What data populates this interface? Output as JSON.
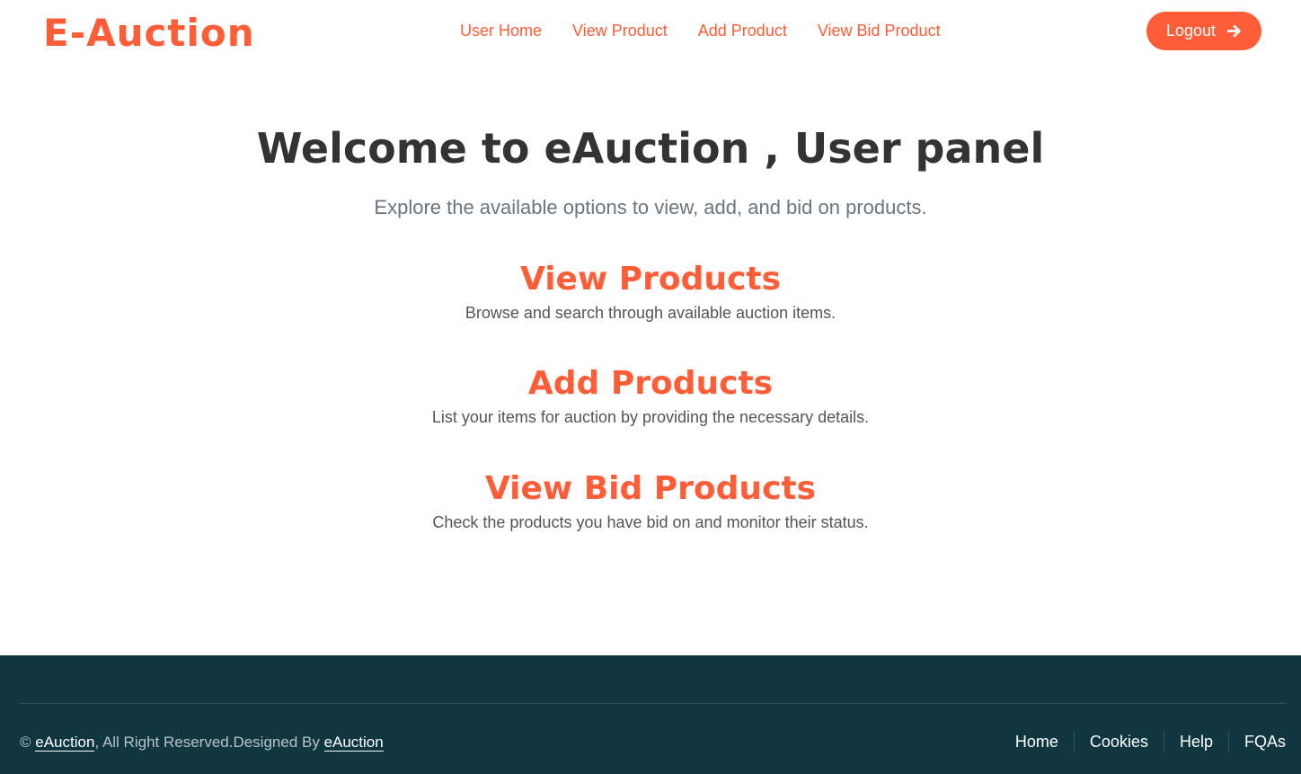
{
  "header": {
    "brand": "E-Auction",
    "nav": [
      "User Home",
      "View Product",
      "Add Product",
      "View Bid Product"
    ],
    "logout_label": "Logout",
    "logout_icon": "arrow-right-icon"
  },
  "main": {
    "title": "Welcome to eAuction , User panel",
    "subtitle": "Explore the available options to view, add, and bid on products.",
    "options": [
      {
        "title": "View Products",
        "description": "Browse and search through available auction items."
      },
      {
        "title": "Add Products",
        "description": "List your items for auction by providing the necessary details."
      },
      {
        "title": "View Bid Products",
        "description": "Check the products you have bid on and monitor their status."
      }
    ]
  },
  "footer": {
    "copyright_symbol": "©",
    "brand_link": "eAuction",
    "rights_text": ", All Right Reserved.Designed By ",
    "designer_link": "eAuction",
    "links": [
      "Home",
      "Cookies",
      "Help",
      "FQAs"
    ]
  },
  "colors": {
    "accent": "#FE5D37",
    "heading": "#333333",
    "footer_bg": "#103741"
  }
}
